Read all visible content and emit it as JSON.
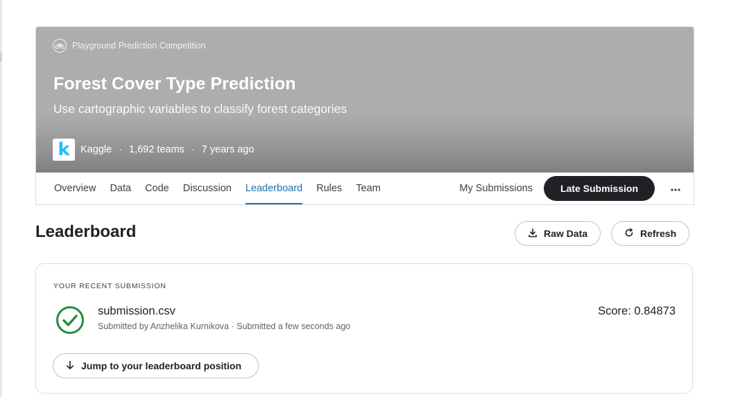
{
  "competition": {
    "type_label": "Playground Prediction Competition",
    "title": "Forest Cover Type Prediction",
    "subtitle": "Use cartographic variables to classify forest categories",
    "host_logo_letter": "k",
    "host": "Kaggle",
    "teams": "1,692 teams",
    "age": "7 years ago",
    "separator": "·"
  },
  "tabs": [
    {
      "label": "Overview",
      "active": false
    },
    {
      "label": "Data",
      "active": false
    },
    {
      "label": "Code",
      "active": false
    },
    {
      "label": "Discussion",
      "active": false
    },
    {
      "label": "Leaderboard",
      "active": true
    },
    {
      "label": "Rules",
      "active": false
    },
    {
      "label": "Team",
      "active": false
    }
  ],
  "tab_actions": {
    "my_submissions": "My Submissions",
    "late_submission": "Late Submission",
    "more_icon": "more-horizontal-icon"
  },
  "leaderboard": {
    "title": "Leaderboard",
    "raw_data": "Raw Data",
    "refresh": "Refresh"
  },
  "recent_submission": {
    "section_label": "YOUR RECENT SUBMISSION",
    "file_name": "submission.csv",
    "meta": "Submitted by Anzhelika Kurnikova · Submitted a few seconds ago",
    "score": "Score: 0.84873",
    "status_icon": "check-circle-icon",
    "jump_label": "Jump to your leaderboard position"
  },
  "colors": {
    "accent": "#1a73a8",
    "success": "#1e8e3e",
    "primary_button": "#202124",
    "banner": "#adadad",
    "kaggle_blue": "#20beff"
  }
}
